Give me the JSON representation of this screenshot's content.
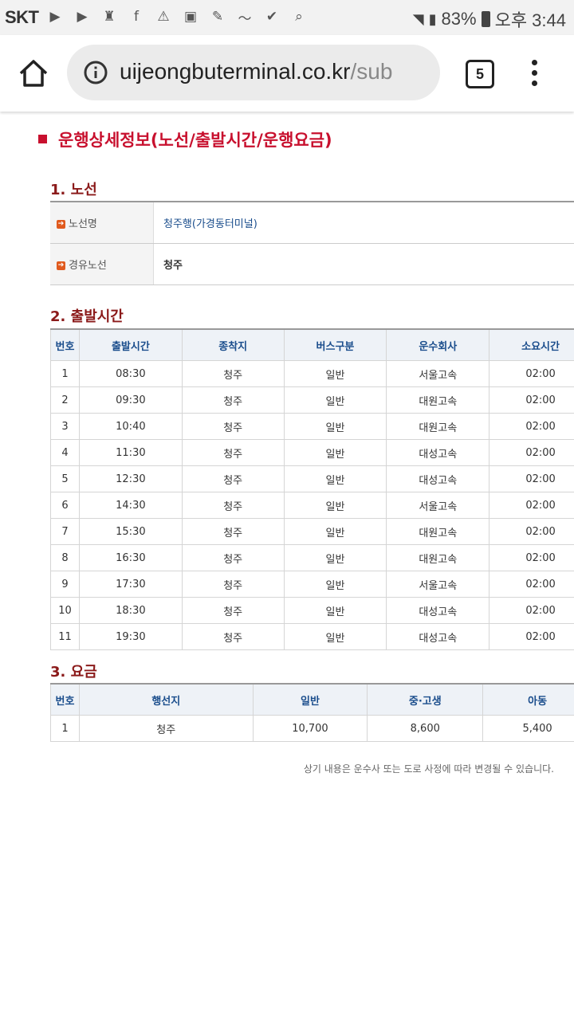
{
  "status_bar": {
    "carrier": "SKT",
    "battery": "83%",
    "time": "오후 3:44",
    "icons": [
      "youtube-icon",
      "youtube-icon",
      "flashlight-icon",
      "facebook-icon",
      "warning-icon",
      "image-icon",
      "app-icon",
      "activity-icon",
      "check-icon",
      "search-icon"
    ]
  },
  "browser": {
    "url_main": "uijeongbuterminal.co.kr",
    "url_rest": "/sub",
    "tab_count": "5"
  },
  "page": {
    "title": "운행상세정보(노선/출발시간/운행요금)",
    "section1_title": "1. 노선",
    "section2_title": "2. 출발시간",
    "section3_title": "3. 요금",
    "notice": "상기 내용은 운수사 또는 도로 사정에 따라 변경될 수 있습니다."
  },
  "route": {
    "rows": [
      {
        "label": "노선명",
        "value": "청주행(가경동터미널)"
      },
      {
        "label": "경유노선",
        "value": "청주"
      }
    ]
  },
  "schedule": {
    "headers": [
      "번호",
      "출발시간",
      "종착지",
      "버스구분",
      "운수회사",
      "소요시간"
    ],
    "rows": [
      [
        "1",
        "08:30",
        "청주",
        "일반",
        "서울고속",
        "02:00"
      ],
      [
        "2",
        "09:30",
        "청주",
        "일반",
        "대원고속",
        "02:00"
      ],
      [
        "3",
        "10:40",
        "청주",
        "일반",
        "대원고속",
        "02:00"
      ],
      [
        "4",
        "11:30",
        "청주",
        "일반",
        "대성고속",
        "02:00"
      ],
      [
        "5",
        "12:30",
        "청주",
        "일반",
        "대성고속",
        "02:00"
      ],
      [
        "6",
        "14:30",
        "청주",
        "일반",
        "서울고속",
        "02:00"
      ],
      [
        "7",
        "15:30",
        "청주",
        "일반",
        "대원고속",
        "02:00"
      ],
      [
        "8",
        "16:30",
        "청주",
        "일반",
        "대원고속",
        "02:00"
      ],
      [
        "9",
        "17:30",
        "청주",
        "일반",
        "서울고속",
        "02:00"
      ],
      [
        "10",
        "18:30",
        "청주",
        "일반",
        "대성고속",
        "02:00"
      ],
      [
        "11",
        "19:30",
        "청주",
        "일반",
        "대성고속",
        "02:00"
      ]
    ]
  },
  "fares": {
    "headers": [
      "번호",
      "행선지",
      "일반",
      "중·고생",
      "아동"
    ],
    "rows": [
      [
        "1",
        "청주",
        "10,700",
        "8,600",
        "5,400"
      ]
    ]
  }
}
